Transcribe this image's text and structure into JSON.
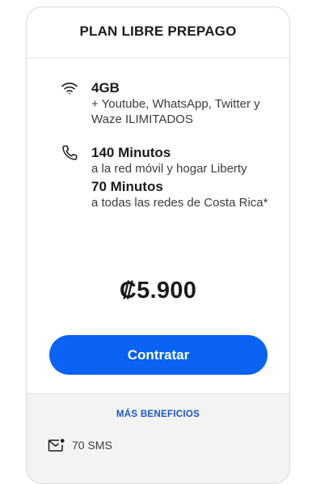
{
  "plan": {
    "title": "PLAN LIBRE PREPAGO",
    "data_feature": {
      "icon": "wifi-icon",
      "headline": "4GB",
      "description": "+ Youtube, WhatsApp, Twitter y Waze ILIMITADOS"
    },
    "voice_feature": {
      "icon": "phone-icon",
      "minutes_primary": "140 Minutos",
      "minutes_primary_desc": "a la red móvil y hogar Liberty",
      "minutes_secondary": "70 Minutos",
      "minutes_secondary_desc": "a todas las redes de Costa Rica*"
    },
    "price": "₡5.900",
    "cta_label": "Contratar",
    "cta_color": "#0a63f2"
  },
  "benefits": {
    "title": "MÁS BENEFICIOS",
    "title_color": "#1a55c8",
    "items": [
      {
        "icon": "sms-icon",
        "label": "70 SMS"
      }
    ]
  }
}
